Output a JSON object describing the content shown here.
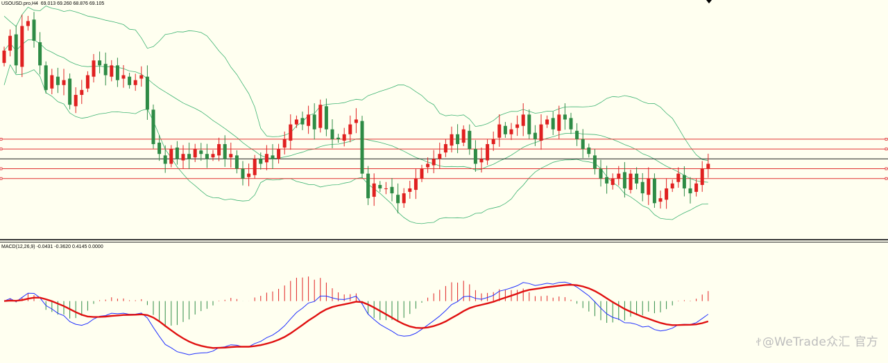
{
  "colors": {
    "background": "#fffff0",
    "bull_candle": "#e02020",
    "bear_candle": "#2e8b45",
    "bollinger": "#3cb371",
    "level_line": "#e03030",
    "current_price_line": "#000000",
    "macd_line": "#2030ff",
    "signal_line": "#e01010",
    "hist_pos": "#e02020",
    "hist_neg": "#2e8b45"
  },
  "header": {
    "main": "USOUSD.pro,H4  69.013 69.260 68.876 69.105",
    "macd": "MACD(12,26,9) -0.0431 -0.3620 0.4145 0.0000"
  },
  "watermark": {
    "icon": "weibo-icon",
    "text": "@WeTrade众汇 官方"
  },
  "chart_data": [
    {
      "type": "candlestick",
      "symbol": "USOUSD.pro",
      "timeframe": "H4",
      "ohlc_header": {
        "open": 69.013,
        "high": 69.26,
        "low": 68.876,
        "close": 69.105
      },
      "ylim": [
        67.6,
        72.4
      ],
      "closes": [
        71.4,
        71.7,
        71.1,
        71.9,
        72.0,
        71.6,
        71.1,
        70.6,
        70.9,
        70.7,
        70.8,
        70.3,
        70.5,
        70.6,
        70.9,
        71.2,
        71.1,
        70.9,
        71.1,
        70.8,
        70.9,
        70.7,
        70.8,
        70.9,
        70.2,
        69.5,
        69.3,
        69.1,
        69.4,
        69.2,
        69.3,
        69.2,
        69.4,
        69.3,
        69.2,
        69.3,
        69.5,
        69.2,
        69.3,
        69.0,
        68.8,
        68.9,
        69.2,
        69.1,
        69.3,
        69.2,
        69.4,
        69.6,
        69.9,
        70.0,
        69.9,
        70.1,
        69.8,
        70.3,
        69.8,
        69.6,
        69.6,
        69.7,
        69.9,
        70.0,
        68.9,
        68.4,
        68.7,
        68.6,
        68.6,
        68.5,
        68.3,
        68.5,
        68.6,
        68.8,
        69.0,
        69.1,
        69.2,
        69.3,
        69.5,
        69.7,
        69.5,
        69.8,
        69.4,
        69.1,
        69.2,
        69.5,
        69.6,
        69.9,
        69.7,
        69.8,
        69.9,
        70.1,
        69.7,
        69.6,
        69.9,
        70.0,
        69.8,
        70.1,
        70.0,
        69.8,
        69.6,
        69.4,
        69.3,
        69.0,
        68.8,
        68.7,
        68.8,
        68.9,
        68.6,
        68.9,
        68.7,
        68.5,
        68.8,
        68.3,
        68.4,
        68.6,
        68.7,
        68.9,
        68.6,
        68.5,
        68.7,
        69.0,
        69.1
      ],
      "bollinger": {
        "period": 20,
        "deviations": 2
      },
      "horizontal_levels": [
        69.6,
        69.4,
        69.0,
        68.8
      ],
      "current_price": 69.2
    },
    {
      "type": "line",
      "indicator": "MACD",
      "params": [
        12,
        26,
        9
      ],
      "header_values": [
        -0.0431,
        -0.362,
        0.4145,
        0.0
      ],
      "series": [
        {
          "name": "MACD(12,26,9)",
          "role": "macd"
        },
        {
          "role": "signal"
        }
      ],
      "ylim": [
        -0.9,
        0.85
      ]
    }
  ]
}
